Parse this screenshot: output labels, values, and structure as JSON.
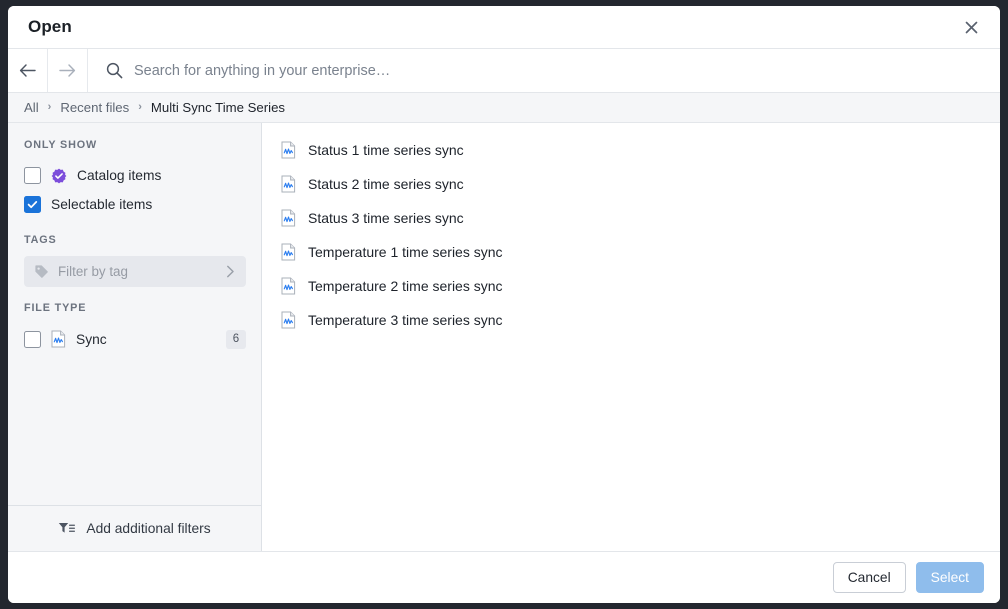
{
  "dialog": {
    "title": "Open",
    "close_icon": "close-icon"
  },
  "navigation": {
    "back_icon": "arrow-left-icon",
    "forward_icon": "arrow-right-icon",
    "search_icon": "search-icon",
    "search_value": "",
    "search_placeholder": "Search for anything in your enterprise…"
  },
  "breadcrumb": {
    "items": [
      {
        "label": "All",
        "current": false
      },
      {
        "label": "Recent files",
        "current": false
      },
      {
        "label": "Multi Sync Time Series",
        "current": true
      }
    ],
    "separator": "›"
  },
  "sidebar": {
    "only_show": {
      "heading": "ONLY SHOW",
      "items": [
        {
          "label": "Catalog items",
          "checked": false,
          "badge_icon": "catalog-seal-icon"
        },
        {
          "label": "Selectable items",
          "checked": true,
          "badge_icon": ""
        }
      ]
    },
    "tags": {
      "heading": "TAGS",
      "tag_icon": "tag-icon",
      "placeholder": "Filter by tag",
      "chevron_icon": "chevron-right-icon"
    },
    "file_type": {
      "heading": "FILE TYPE",
      "items": [
        {
          "label": "Sync",
          "checked": false,
          "count": "6",
          "icon": "sync-file-icon"
        }
      ]
    },
    "add_filters": {
      "label": "Add additional filters",
      "icon": "filter-list-icon"
    }
  },
  "filelist": {
    "items": [
      {
        "name": "Status 1 time series sync",
        "icon": "sync-file-icon"
      },
      {
        "name": "Status 2 time series sync",
        "icon": "sync-file-icon"
      },
      {
        "name": "Status 3 time series sync",
        "icon": "sync-file-icon"
      },
      {
        "name": "Temperature 1 time series sync",
        "icon": "sync-file-icon"
      },
      {
        "name": "Temperature 2 time series sync",
        "icon": "sync-file-icon"
      },
      {
        "name": "Temperature 3 time series sync",
        "icon": "sync-file-icon"
      }
    ]
  },
  "footer": {
    "cancel_label": "Cancel",
    "select_label": "Select",
    "select_disabled": true
  },
  "colors": {
    "accent_blue": "#1a73d9",
    "catalog_purple": "#7c4ddb",
    "select_disabled_blue": "#8fbdec",
    "sidebar_bg": "#f5f6f8",
    "backdrop": "#23272f"
  }
}
